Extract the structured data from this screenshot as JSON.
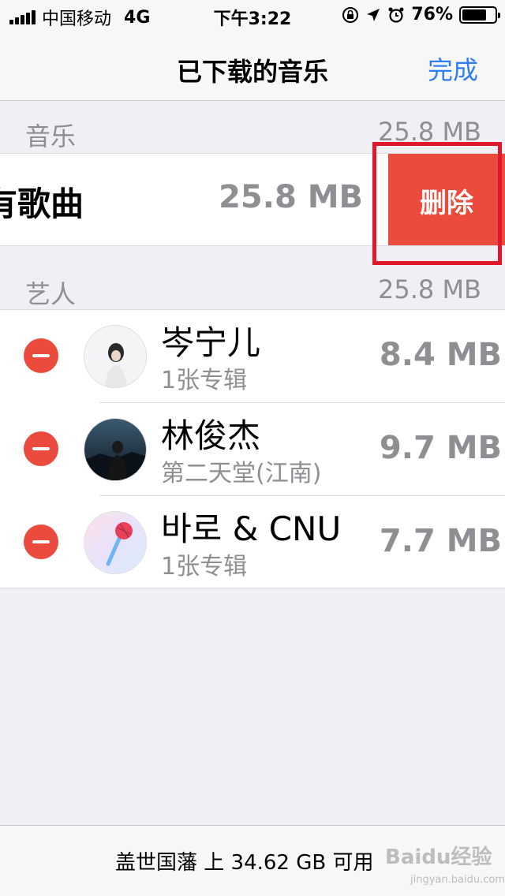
{
  "status_bar": {
    "carrier": "中国移动",
    "network": "4G",
    "time": "下午3:22",
    "battery_percent": "76%",
    "battery_level": 0.76,
    "icons": [
      "signal-icon",
      "orientation-lock-icon",
      "location-icon",
      "alarm-icon",
      "battery-icon"
    ]
  },
  "nav": {
    "title": "已下载的音乐",
    "done_label": "完成"
  },
  "music_section": {
    "label": "音乐",
    "size": "25.8 MB"
  },
  "all_songs": {
    "title": "有歌曲",
    "size": "25.8 MB",
    "delete_label": "删除"
  },
  "artists_section": {
    "label": "艺人",
    "size": "25.8 MB"
  },
  "artists": [
    {
      "name": "岑宁儿",
      "subtitle": "1张专辑",
      "size": "8.4 MB"
    },
    {
      "name": "林俊杰",
      "subtitle": "第二天堂(江南)",
      "size": "9.7 MB"
    },
    {
      "name": "바로 & CNU",
      "subtitle": "1张专辑",
      "size": "7.7 MB"
    }
  ],
  "footer": {
    "storage_text": "盖世国藩 上 34.62 GB 可用"
  },
  "watermark": {
    "text": "Baidu经验",
    "sub": "jingyan.baidu.com"
  },
  "colors": {
    "accent": "#2f7df6",
    "delete": "#ea4b3c",
    "highlight": "#e0182c"
  }
}
